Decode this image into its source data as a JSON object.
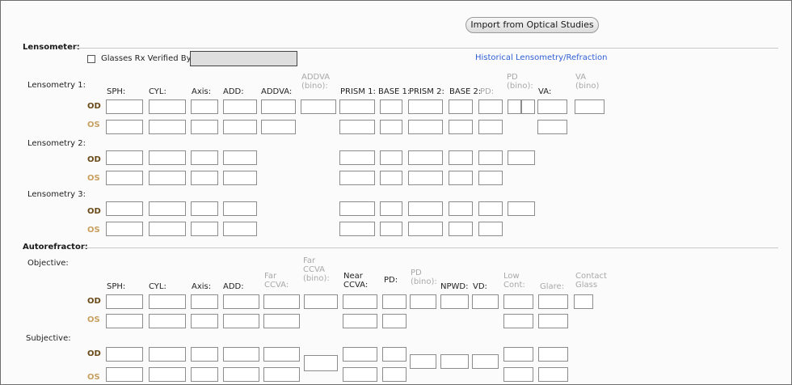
{
  "buttons": {
    "import_label": "Import from Optical Studies"
  },
  "links": {
    "historical": "Historical Lensometry/Refraction"
  },
  "lensometer": {
    "section_title": "Lensometer:",
    "verified_label": "Glasses Rx Verified By:",
    "verified_value": "",
    "groups": [
      "Lensometry 1:",
      "Lensometry 2:",
      "Lensometry 3:"
    ],
    "headers": {
      "sph": "SPH:",
      "cyl": "CYL:",
      "axis": "Axis:",
      "add": "ADD:",
      "addva": "ADDVA:",
      "addva_bino": "ADDVA (bino):",
      "prism1": "PRISM 1:",
      "base1": "BASE 1:",
      "prism2": "PRISM 2:",
      "base2": "BASE 2:",
      "pd": "PD:",
      "pd_bino": "PD (bino):",
      "va": "VA:",
      "va_bino": "VA (bino)"
    }
  },
  "autorefractor": {
    "section_title": "Autorefractor:",
    "objective_label": "Objective:",
    "subjective_label": "Subjective:",
    "headers": {
      "sph": "SPH:",
      "cyl": "CYL:",
      "axis": "Axis:",
      "add": "ADD:",
      "far_ccva": "Far CCVA:",
      "far_ccva_bino": "Far CCVA (bino):",
      "near_ccva": "Near CCVA:",
      "pd": "PD:",
      "pd_bino": "PD (bino):",
      "npwd": "NPWD:",
      "vd": "VD:",
      "low_cont": "Low Cont:",
      "glare": "Glare:",
      "contact_glass": "Contact Glass"
    }
  },
  "eyes": {
    "od": "OD",
    "os": "OS"
  },
  "colors": {
    "link": "#2e5fd6",
    "od": "#6a4a1a",
    "os": "#c8a060",
    "dim_header": "#a8a8a8"
  }
}
